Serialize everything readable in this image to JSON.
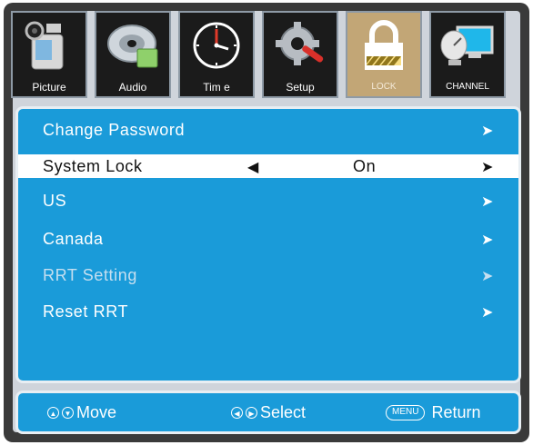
{
  "tabs": [
    {
      "label": "Picture",
      "icon": "camcorder-icon"
    },
    {
      "label": "Audio",
      "icon": "disc-icon"
    },
    {
      "label": "Tim e",
      "icon": "clock-icon"
    },
    {
      "label": "Setup",
      "icon": "gear-tools-icon"
    },
    {
      "label": "LOCK",
      "icon": "padlock-icon",
      "active": true
    },
    {
      "label": "CHANNEL",
      "icon": "satellite-monitor-icon"
    }
  ],
  "menu": {
    "items": [
      {
        "label": "Change Password",
        "arrow_right": "➤"
      },
      {
        "label": "System Lock",
        "value": "On",
        "arrow_left": "◀",
        "arrow_right": "➤",
        "selected": true
      },
      {
        "label": "US",
        "arrow_right": "➤"
      },
      {
        "label": "Canada",
        "arrow_right": "➤"
      },
      {
        "label": "RRT Setting",
        "arrow_right": "➤",
        "disabled": true
      },
      {
        "label": "Reset RRT",
        "arrow_right": "➤"
      }
    ]
  },
  "footer": {
    "move_label": "Move",
    "select_label": "Select",
    "menu_key": "MENU",
    "return_label": "Return",
    "up_glyph": "▲",
    "down_glyph": "▼",
    "left_glyph": "◀",
    "right_glyph": "▶"
  },
  "colors": {
    "panel_blue": "#1a9bd9",
    "active_tab": "#c2a676",
    "frame": "#3a3a3a"
  }
}
